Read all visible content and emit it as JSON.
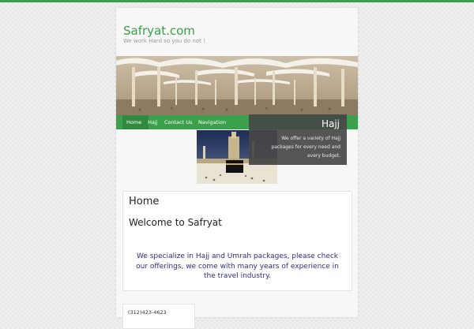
{
  "site": {
    "title": "Safryat.com",
    "tagline": "We work Hard so you do not !"
  },
  "banner": {
    "image": "mosque-umbrellas-photo"
  },
  "nav": {
    "items": [
      {
        "label": "Home",
        "active": true
      },
      {
        "label": "Hajj"
      },
      {
        "label": "Contact Us"
      },
      {
        "label": "Navigation"
      }
    ]
  },
  "slider": {
    "image": "kaaba-photo",
    "title": "Hajj",
    "caption": "We offer a variety of Hajj packages for every need and every budget."
  },
  "page": {
    "title": "Home",
    "heading": "Welcome to Safryat",
    "body": "We specialize in Hajj and Umrah packages, please check our offerings, we come with many years of experience in the travel industry."
  },
  "contact": {
    "phone": "(312)423-4623"
  },
  "colors": {
    "brand_green": "#3aa04c",
    "nav_active": "#2f8a40",
    "body_text_blue": "#2f2f86",
    "caption_bg": "#464646"
  }
}
